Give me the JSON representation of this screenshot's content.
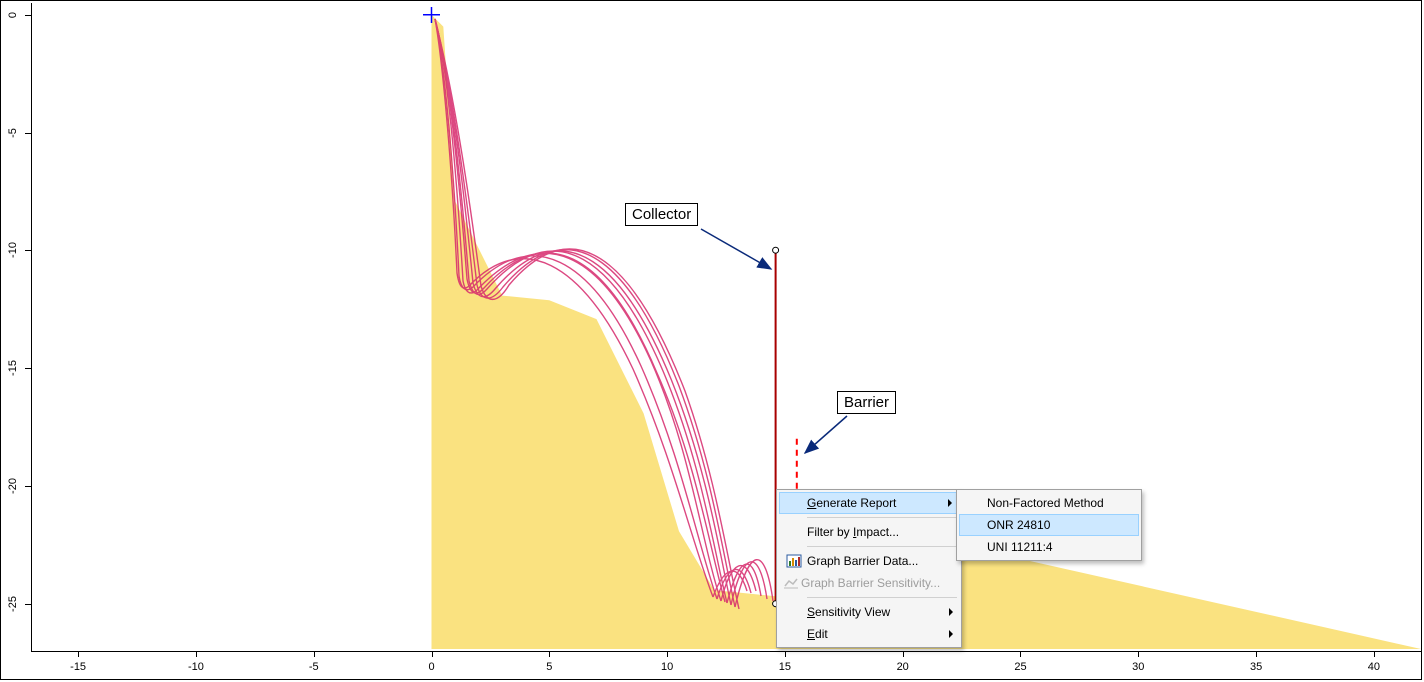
{
  "chart_data": {
    "type": "line",
    "xlim": [
      -17,
      42
    ],
    "ylim": [
      -27,
      0.5
    ],
    "x_ticks": [
      -15,
      -10,
      -5,
      0,
      5,
      10,
      15,
      20,
      25,
      30,
      35,
      40
    ],
    "y_ticks": [
      0,
      -5,
      -10,
      -15,
      -20,
      -25
    ],
    "terrain_profile": [
      [
        0,
        0
      ],
      [
        0.5,
        -0.5
      ],
      [
        1,
        -8
      ],
      [
        3,
        -12
      ],
      [
        5,
        -12.2
      ],
      [
        7,
        -13
      ],
      [
        9,
        -17
      ],
      [
        10.5,
        -22
      ],
      [
        12,
        -24.5
      ],
      [
        15,
        -24.8
      ],
      [
        17,
        -25.5
      ],
      [
        22,
        -22.5
      ]
    ],
    "annotations": [
      {
        "label": "Collector",
        "target_x": 14.6,
        "target_y": -10
      },
      {
        "label": "Barrier",
        "target_x": 15.5,
        "target_y": -18
      }
    ],
    "barriers": [
      {
        "name": "Collector",
        "x": 14.6,
        "y_top": -10,
        "y_bottom": -25,
        "style": "solid"
      },
      {
        "name": "Barrier",
        "x": 15.5,
        "y_top": -18,
        "y_bottom": -21,
        "style": "dashed"
      }
    ],
    "seeder": {
      "x": 0,
      "y": 0
    },
    "trajectory_note": "multiple rockfall trajectories (magenta) from seeder bouncing along terrain toward collector"
  },
  "callouts": {
    "collector": "Collector",
    "barrier": "Barrier"
  },
  "context_menu": {
    "items": [
      {
        "key": "generate",
        "label": "Generate Report",
        "has_sub": true,
        "enabled": true,
        "highlight": true,
        "underline_index": 0
      },
      {
        "sep": true
      },
      {
        "key": "filter",
        "label": "Filter by Impact...",
        "enabled": true,
        "underline_index": 10
      },
      {
        "sep": true
      },
      {
        "key": "graphbarrier",
        "label": "Graph Barrier Data...",
        "enabled": true,
        "icon": "chart-icon"
      },
      {
        "key": "graphsens",
        "label": "Graph Barrier Sensitivity...",
        "enabled": false,
        "icon": "chart-grey-icon"
      },
      {
        "sep": true
      },
      {
        "key": "sensview",
        "label": "Sensitivity View",
        "has_sub": true,
        "enabled": true,
        "underline_index": 0
      },
      {
        "key": "edit",
        "label": "Edit",
        "has_sub": true,
        "enabled": true,
        "underline_index": 0
      }
    ],
    "submenu": {
      "parent": "generate",
      "items": [
        {
          "key": "nonfactored",
          "label": "Non-Factored Method"
        },
        {
          "key": "onr",
          "label": "ONR 24810",
          "highlight": true
        },
        {
          "key": "uni",
          "label": "UNI 11211:4"
        }
      ]
    }
  },
  "colors": {
    "terrain": "#fae280",
    "trajectory": "#d6296c",
    "collector_line": "#a80000",
    "barrier_line": "#ff0000",
    "seeder": "#0000ff",
    "arrow": "#0a2a7a"
  }
}
